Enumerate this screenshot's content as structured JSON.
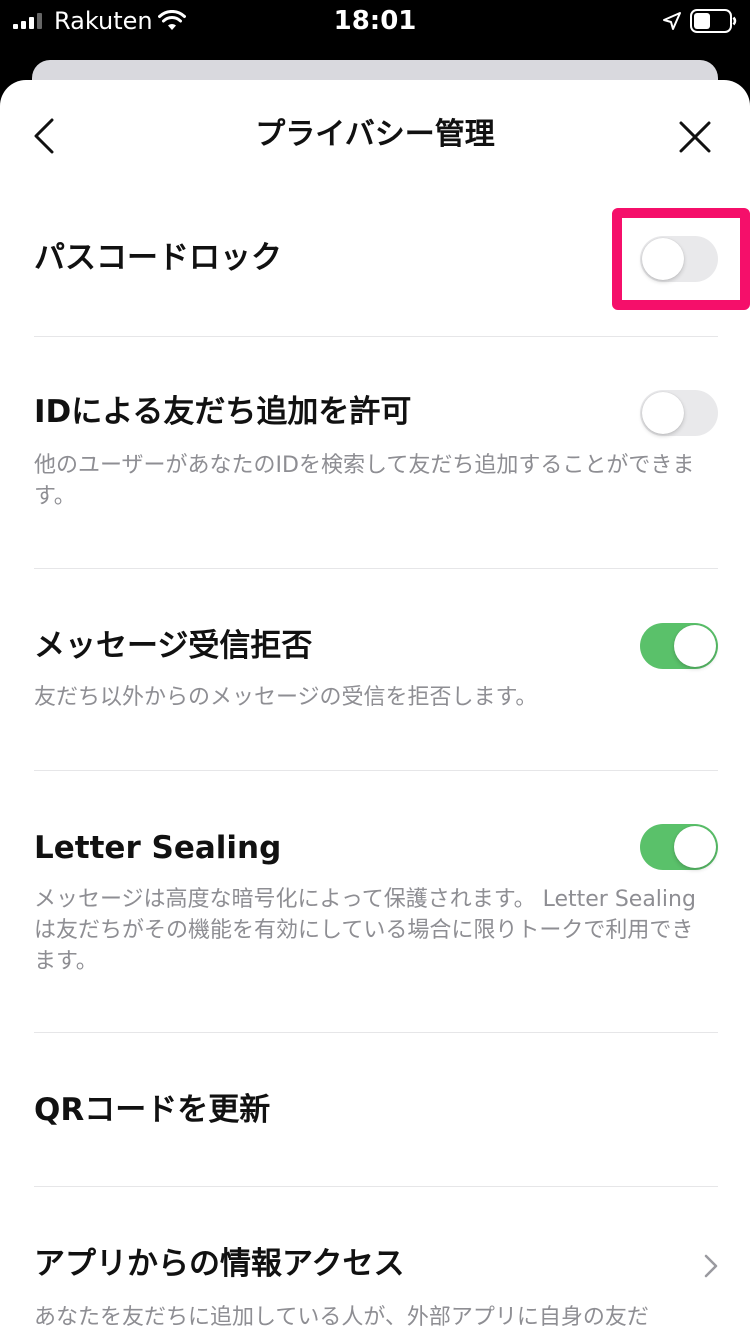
{
  "status_bar": {
    "carrier": "Rakuten",
    "time": "18:01"
  },
  "header": {
    "title": "プライバシー管理"
  },
  "settings": [
    {
      "title": "パスコードロック",
      "toggle": "off"
    },
    {
      "title": "IDによる友だち追加を許可",
      "description": "他のユーザーがあなたのIDを検索して友だち追加することができます。",
      "toggle": "off"
    },
    {
      "title": "メッセージ受信拒否",
      "description": "友だち以外からのメッセージの受信を拒否します。",
      "toggle": "on"
    },
    {
      "title": "Letter Sealing",
      "description": "メッセージは高度な暗号化によって保護されます。 Letter Sealingは友だちがその機能を有効にしている場合に限りトークで利用できます。",
      "toggle": "on"
    },
    {
      "title": "QRコードを更新"
    },
    {
      "title": "アプリからの情報アクセス",
      "description": "あなたを友だちに追加している人が、外部アプリに自身の友だ"
    }
  ],
  "colors": {
    "toggle_on": "#5ac16a",
    "toggle_off": "#e9e9eb",
    "highlight": "#f50f6a"
  }
}
